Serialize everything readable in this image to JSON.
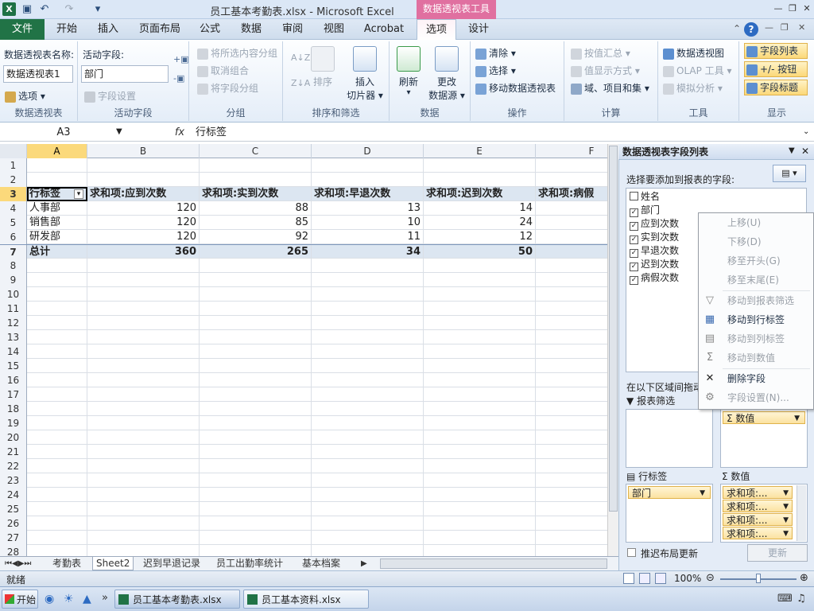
{
  "window": {
    "title": "员工基本考勤表.xlsx - Microsoft Excel",
    "context_tab_title": "数据透视表工具"
  },
  "tabs": {
    "file": "文件",
    "items": [
      "开始",
      "插入",
      "页面布局",
      "公式",
      "数据",
      "审阅",
      "视图",
      "Acrobat",
      "选项",
      "设计"
    ]
  },
  "ribbon": {
    "pivot_group": {
      "name_label": "数据透视表名称:",
      "name_value": "数据透视表1",
      "options": "选项",
      "label": "数据透视表"
    },
    "active_field_group": {
      "label_text": "活动字段:",
      "value": "部门",
      "settings": "字段设置",
      "label": "活动字段"
    },
    "group_group": {
      "items": [
        "将所选内容分组",
        "取消组合",
        "将字段分组"
      ],
      "label": "分组"
    },
    "sort_group": {
      "sort": "排序",
      "insert": "插入",
      "slicer": "切片器",
      "label": "排序和筛选"
    },
    "data_group": {
      "refresh": "刷新",
      "change": "更改",
      "source": "数据源",
      "label": "数据"
    },
    "ops_group": {
      "clear": "清除",
      "select": "选择",
      "move": "移动数据透视表",
      "label": "操作"
    },
    "calc_group": {
      "items": [
        "按值汇总",
        "值显示方式",
        "域、项目和集"
      ],
      "label": "计算"
    },
    "tools_group": {
      "items": [
        "数据透视图",
        "OLAP 工具",
        "模拟分析"
      ],
      "label": "工具"
    },
    "show_group": {
      "items": [
        "字段列表",
        "+/- 按钮",
        "字段标题"
      ],
      "label": "显示"
    }
  },
  "formula_bar": {
    "name_box": "A3",
    "fx": "fx",
    "content": "行标签"
  },
  "columns": [
    "A",
    "B",
    "C",
    "D",
    "E",
    "F"
  ],
  "rows": [
    "1",
    "2",
    "3",
    "4",
    "5",
    "6",
    "7",
    "8",
    "9",
    "10",
    "11",
    "12",
    "13",
    "14",
    "15",
    "16",
    "17",
    "18",
    "19",
    "20",
    "21",
    "22",
    "23",
    "24",
    "25",
    "26",
    "27",
    "28"
  ],
  "pivot": {
    "headers": [
      "行标签",
      "求和项:应到次数",
      "求和项:实到次数",
      "求和项:早退次数",
      "求和项:迟到次数",
      "求和项:病假"
    ],
    "data": [
      [
        "人事部",
        "120",
        "88",
        "13",
        "14"
      ],
      [
        "销售部",
        "120",
        "85",
        "10",
        "24"
      ],
      [
        "研发部",
        "120",
        "92",
        "11",
        "12"
      ]
    ],
    "total": [
      "总计",
      "360",
      "265",
      "34",
      "50"
    ]
  },
  "sheets": [
    "考勤表",
    "Sheet2",
    "迟到早退记录",
    "员工出勤率统计",
    "基本档案"
  ],
  "status": {
    "ready": "就绪",
    "zoom": "100%"
  },
  "pane": {
    "title": "数据透视表字段列表",
    "choose_label": "选择要添加到报表的字段:",
    "fields": [
      {
        "name": "姓名",
        "checked": false
      },
      {
        "name": "部门",
        "checked": true
      },
      {
        "name": "应到次数",
        "checked": true
      },
      {
        "name": "实到次数",
        "checked": true
      },
      {
        "name": "早退次数",
        "checked": true
      },
      {
        "name": "迟到次数",
        "checked": true
      },
      {
        "name": "病假次数",
        "checked": true
      }
    ],
    "drag_label": "在以下区域间拖动",
    "report_filter": "报表筛选",
    "col_labels_chip": "数值",
    "row_labels": "行标签",
    "values": "数值",
    "row_chip": "部门",
    "value_chips": [
      "求和项:...",
      "求和项:...",
      "求和项:...",
      "求和项:..."
    ],
    "defer": "推迟布局更新",
    "update": "更新"
  },
  "context_menu": {
    "items": [
      "上移(U)",
      "下移(D)",
      "移至开头(G)",
      "移至末尾(E)",
      "移动到报表筛选",
      "移动到行标签",
      "移动到列标签",
      "移动到数值",
      "删除字段",
      "字段设置(N)..."
    ]
  },
  "taskbar": {
    "start": "开始",
    "tasks": [
      "员工基本考勤表.xlsx",
      "员工基本资料.xlsx"
    ]
  },
  "colors": {
    "excel_green": "#217346",
    "context_pink": "#e070a0",
    "selection": "#fbd97b",
    "pivot_header": "#dce6f1"
  }
}
